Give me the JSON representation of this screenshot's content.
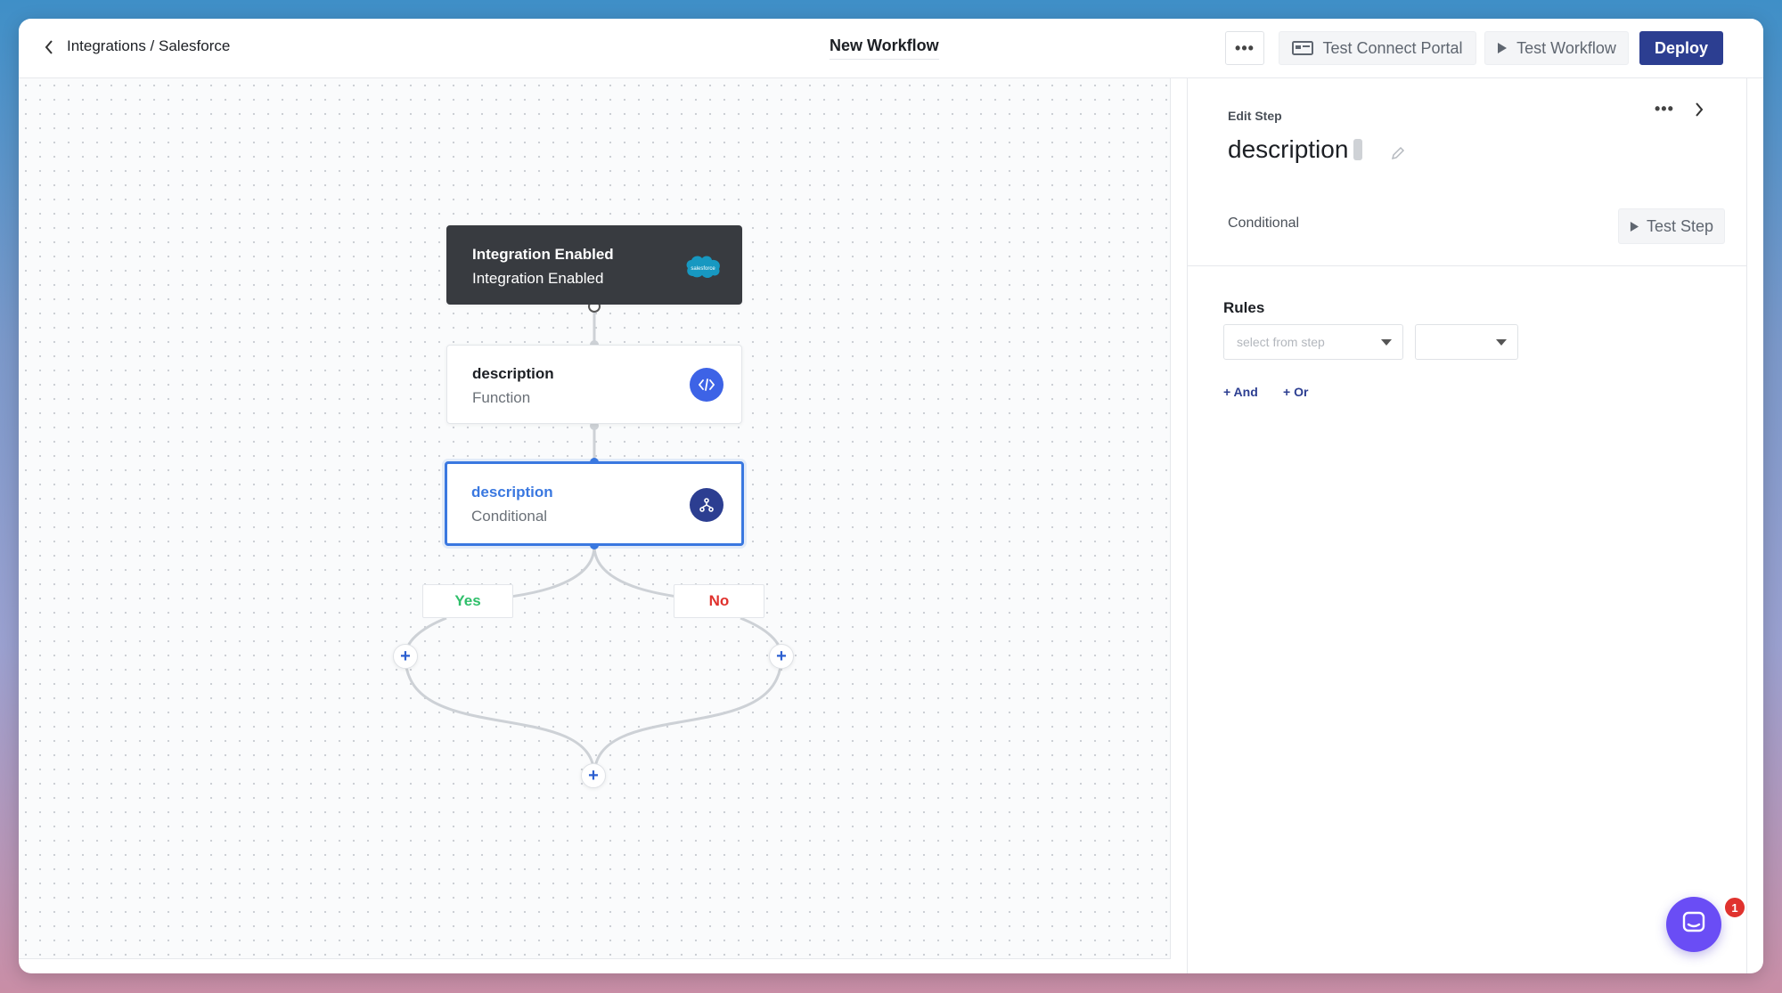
{
  "header": {
    "breadcrumb": "Integrations / Salesforce",
    "workflow_title": "New Workflow",
    "more_label": "•••",
    "test_connect_portal": "Test Connect Portal",
    "test_workflow": "Test Workflow",
    "deploy": "Deploy"
  },
  "canvas": {
    "nodes": [
      {
        "title": "Integration Enabled",
        "subtitle": "Integration Enabled",
        "icon": "salesforce-logo",
        "logo_text": "salesforce"
      },
      {
        "title": "description",
        "subtitle": "Function",
        "icon": "code-icon"
      },
      {
        "title": "description",
        "subtitle": "Conditional",
        "icon": "branch-icon"
      }
    ],
    "branches": {
      "yes": "Yes",
      "no": "No"
    }
  },
  "panel": {
    "edit_label": "Edit Step",
    "more_label": "•••",
    "step_name": "description",
    "step_type": "Conditional",
    "test_step": "Test Step",
    "rules_label": "Rules",
    "select_step_placeholder": "select from step",
    "and_link": "+ And",
    "or_link": "+ Or"
  },
  "chat": {
    "badge_count": "1"
  },
  "colors": {
    "deploy_bg": "#2c3e91",
    "accent_blue": "#3a78e0",
    "yes_green": "#2fbf6a",
    "no_red": "#e0322e",
    "chat_purple": "#6a4df5",
    "trigger_bg": "#383b40"
  }
}
